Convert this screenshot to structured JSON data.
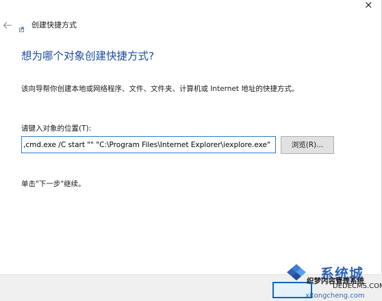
{
  "window": {
    "close_glyph": "×"
  },
  "titlebar": {
    "back_icon": "back-arrow-icon",
    "app_icon": "shortcut-wizard-icon",
    "title": "创建快捷方式"
  },
  "main": {
    "heading": "想为哪个对象创建快捷方式?",
    "description": "该向导帮你创建本地或网络程序、文件、文件夹、计算机或 Internet 地址的快捷方式。",
    "location_label": "请键入对象的位置(T):",
    "location_value": ",cmd.exe /C start \"\" \"C:\\Program Files\\Internet Explorer\\iexplore.exe\"",
    "browse_label": "浏览(R)...",
    "next_hint": "单击\"下一步\"继续。"
  },
  "watermark": {
    "brand": "系统城",
    "subtitle": "织梦内容管理系统",
    "domain": "DEDECMS.COM",
    "pinyin_url": "xitongcheng.com"
  },
  "colors": {
    "heading": "#1e4e9e",
    "input_focus_border": "#2a78d4",
    "footer_bg": "#f0f0f0",
    "watermark_brand": "#2f64b6"
  }
}
